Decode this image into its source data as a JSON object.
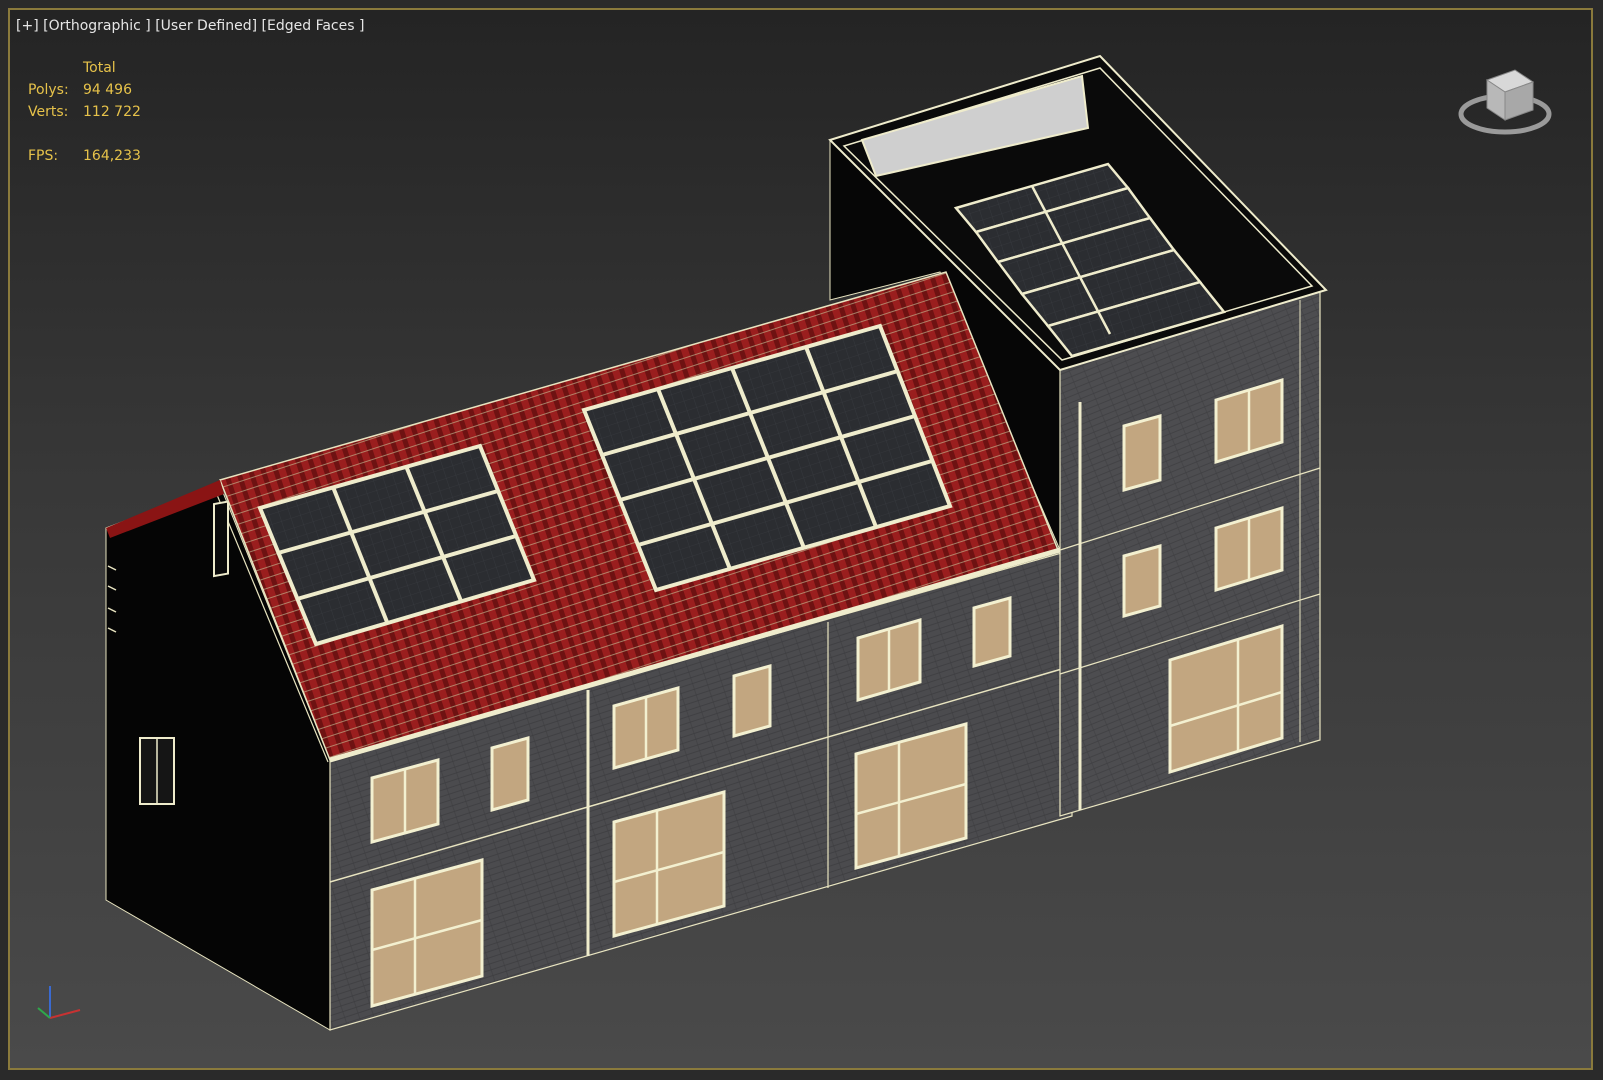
{
  "viewport": {
    "label_plus": "[+]",
    "label_view": "[Orthographic ]",
    "label_shading": "[User Defined]",
    "label_edges": "[Edged Faces ]"
  },
  "stats": {
    "header": "Total",
    "polys_label": "Polys:",
    "polys_value": "94 496",
    "verts_label": "Verts:",
    "verts_value": "112 722",
    "fps_label": "FPS:",
    "fps_value": "164,233"
  },
  "colors": {
    "frame": "#8a7a3c",
    "stats_text": "#e6c24a",
    "roof": "#8a1a1a",
    "wall": "#4a4a4d",
    "edge": "#f0edc8",
    "solar": "#2a2c30",
    "window_fill": "#c2a680"
  },
  "viewcube": {
    "icon": "viewcube-icon"
  },
  "axis_gizmo": {
    "icon": "axis-tripod-icon"
  }
}
